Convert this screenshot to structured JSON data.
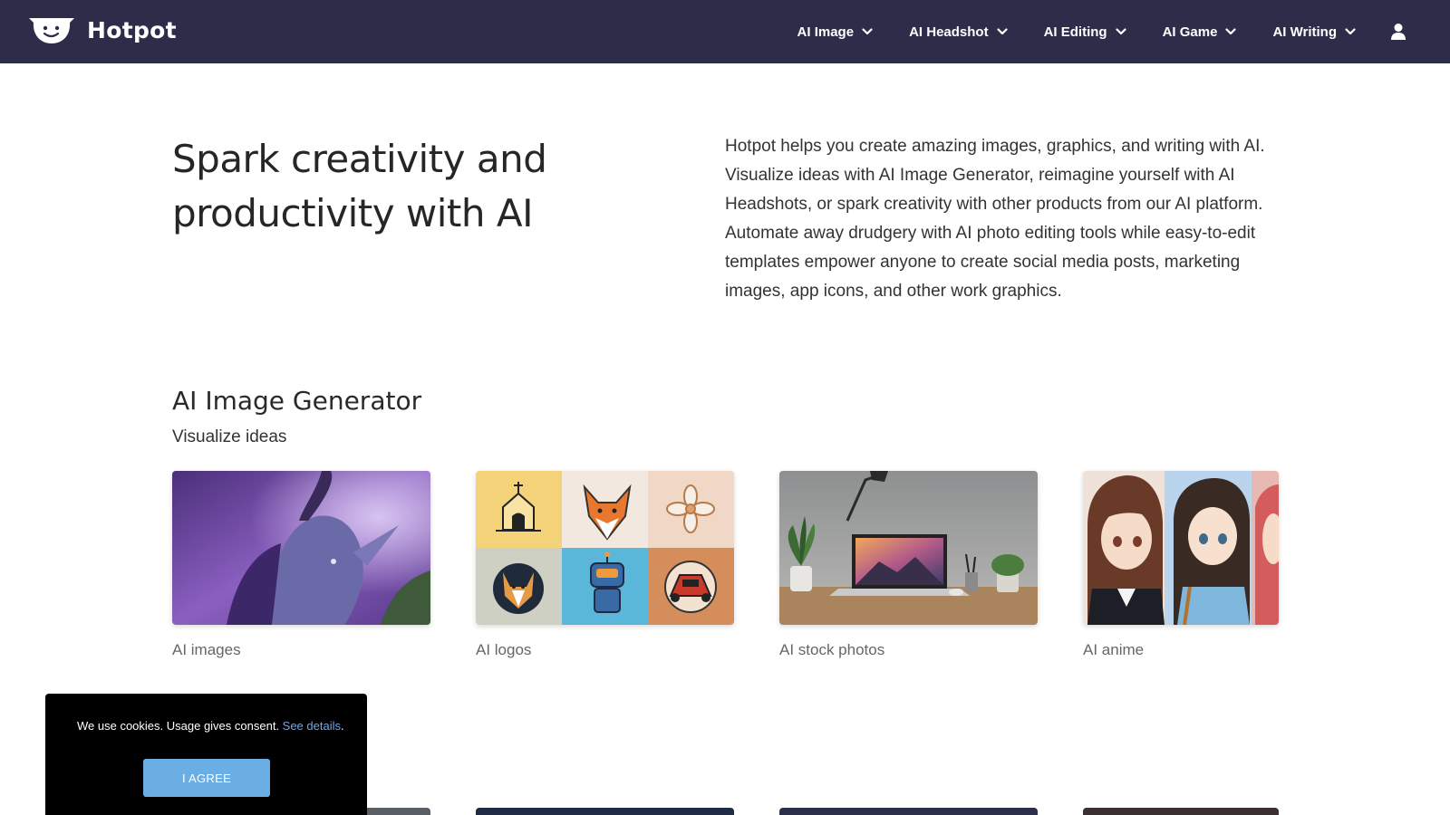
{
  "header": {
    "brand": "Hotpot",
    "nav": [
      {
        "label": "AI Image"
      },
      {
        "label": "AI Headshot"
      },
      {
        "label": "AI Editing"
      },
      {
        "label": "AI Game"
      },
      {
        "label": "AI Writing"
      }
    ]
  },
  "hero": {
    "title": "Spark creativity and productivity with AI",
    "description": "Hotpot helps you create amazing images, graphics, and writing with AI. Visualize ideas with AI Image Generator, reimagine yourself with AI Headshots, or spark creativity with other products from our AI platform. Automate away drudgery with AI photo editing tools while easy-to-edit templates empower anyone to create social media posts, marketing images, app icons, and other work graphics."
  },
  "section": {
    "title": "AI Image Generator",
    "subtitle": "Visualize ideas",
    "cards": [
      {
        "caption": "AI images"
      },
      {
        "caption": "AI logos"
      },
      {
        "caption": "AI stock photos"
      },
      {
        "caption": "AI anime"
      }
    ]
  },
  "cookie": {
    "text": "We use cookies. Usage gives consent. ",
    "link": "See details",
    "period": ".",
    "button": "I AGREE"
  },
  "colors": {
    "header_bg": "#2e2d49",
    "cookie_button": "#6aaee4",
    "link": "#6fa6e8"
  }
}
